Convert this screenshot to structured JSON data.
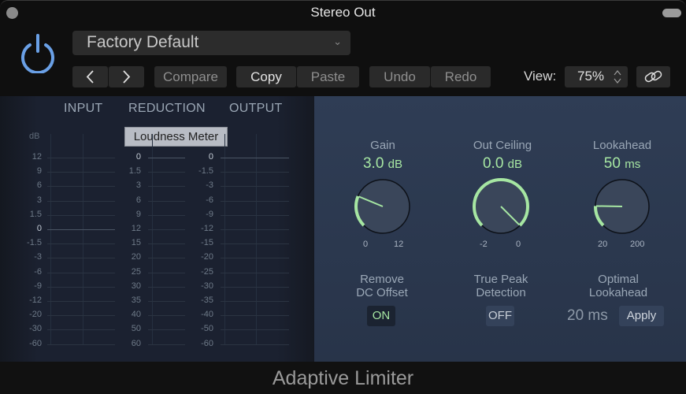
{
  "window": {
    "title": "Stereo Out"
  },
  "toolbar": {
    "power_icon": "power-icon",
    "preset": {
      "value": "Factory Default",
      "chevron_icon": "chevron-down-icon"
    },
    "prev_icon": "chevron-left-icon",
    "next_icon": "chevron-right-icon",
    "compare_label": "Compare",
    "copy_label": "Copy",
    "paste_label": "Paste",
    "undo_label": "Undo",
    "redo_label": "Redo",
    "view_label": "View:",
    "view_value": "75%",
    "link_icon": "link-icon"
  },
  "meters": {
    "headers": {
      "input": "INPUT",
      "reduction": "REDUCTION",
      "output": "OUTPUT"
    },
    "loudness_button": "Loudness Meter",
    "unit": "dB",
    "input_scale": [
      "12",
      "9",
      "6",
      "3",
      "1.5",
      "0",
      "-1.5",
      "-3",
      "-6",
      "-9",
      "-12",
      "-20",
      "-30",
      "-60"
    ],
    "reduction_scale": [
      "0",
      "1.5",
      "3",
      "6",
      "9",
      "12",
      "15",
      "20",
      "25",
      "30",
      "35",
      "40",
      "50",
      "60"
    ],
    "output_scale": [
      "0",
      "-1.5",
      "-3",
      "-6",
      "-9",
      "-12",
      "-15",
      "-20",
      "-25",
      "-30",
      "-35",
      "-40",
      "-50",
      "-60"
    ]
  },
  "controls": {
    "gain": {
      "title": "Gain",
      "value": "3.0",
      "unit": "dB",
      "min": "0",
      "max": "12",
      "fraction": 0.25
    },
    "out_ceiling": {
      "title": "Out Ceiling",
      "value": "0.0",
      "unit": "dB",
      "min": "-2",
      "max": "0",
      "fraction": 1.0
    },
    "lookahead": {
      "title": "Lookahead",
      "value": "50",
      "unit": "ms",
      "min": "20",
      "max": "200",
      "fraction": 0.17
    },
    "remove_dc": {
      "title_line1": "Remove",
      "title_line2": "DC Offset",
      "state": "ON"
    },
    "true_peak": {
      "title_line1": "True Peak",
      "title_line2": "Detection",
      "state": "OFF"
    },
    "optimal_lookahead": {
      "title_line1": "Optimal",
      "title_line2": "Lookahead",
      "value": "20 ms",
      "apply_label": "Apply"
    },
    "accent_color": "#a6e6a2"
  },
  "footer": {
    "plugin_name": "Adaptive Limiter"
  }
}
